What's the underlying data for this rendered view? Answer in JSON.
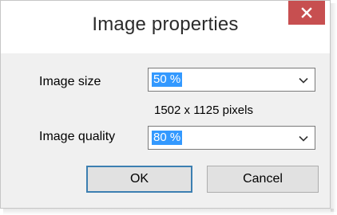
{
  "dialog": {
    "title": "Image properties",
    "close_icon": "close-icon",
    "colors": {
      "close_bg": "#c74f50",
      "selection": "#3399ff",
      "default_button_border": "#3c7fb1"
    }
  },
  "image_size": {
    "label": "Image size",
    "value": "50 %",
    "dimensions": "1502 x 1125 pixels"
  },
  "image_quality": {
    "label": "Image quality",
    "value": "80 %"
  },
  "buttons": {
    "ok": "OK",
    "cancel": "Cancel"
  }
}
